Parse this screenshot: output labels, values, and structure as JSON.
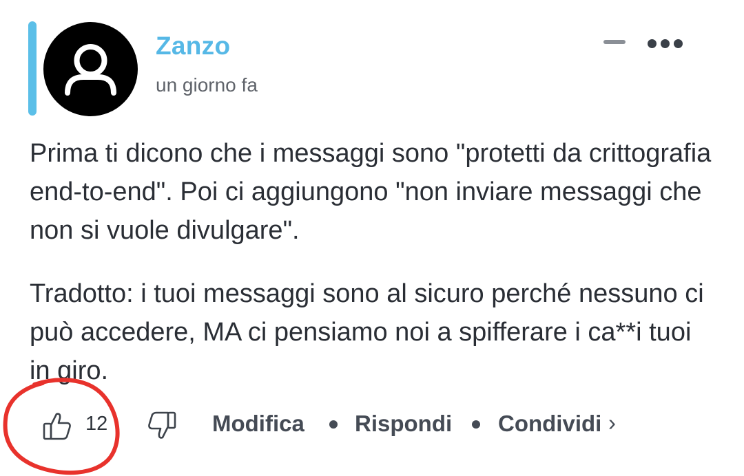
{
  "comment": {
    "author": "Zanzo",
    "timestamp": "un giorno fa",
    "paragraphs": [
      "Prima ti dicono che i messaggi sono \"protetti da crittografia end-to-end\". Poi ci aggiungono \"non inviare messaggi che non si vuole divulgare\".",
      "Tradotto: i tuoi messaggi sono al sicuro perché nessuno ci può accedere, MA ci pensiamo noi a spifferare i ca**i tuoi in giro."
    ],
    "accent_color": "#5bbfe8",
    "author_color": "#56b8e6"
  },
  "actions": {
    "like_count": "12",
    "edit_label": "Modifica",
    "reply_label": "Rispondi",
    "share_label": "Condividi",
    "share_chevron": "›"
  },
  "icons": {
    "avatar": "user-icon",
    "collapse": "minus-icon",
    "more": "more-horizontal-icon",
    "like": "thumbs-up-icon",
    "dislike": "thumbs-down-icon"
  },
  "annotation": {
    "color": "#e8322c"
  }
}
